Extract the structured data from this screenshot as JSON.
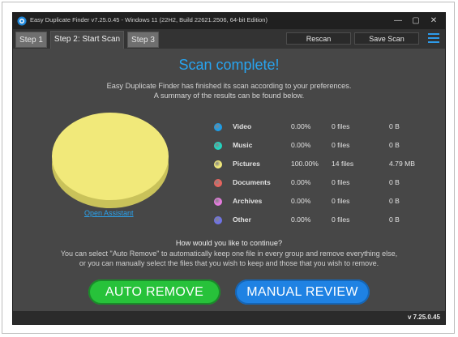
{
  "window": {
    "title": "Easy Duplicate Finder v7.25.0.45 - Windows 11 (22H2, Build 22621.2506, 64-bit Edition)",
    "controls": {
      "minimize": "—",
      "maximize": "▢",
      "close": "✕"
    }
  },
  "tabs": [
    {
      "label": "Step 1",
      "active": false
    },
    {
      "label": "Step 2: Start Scan",
      "active": true
    },
    {
      "label": "Step 3",
      "active": false
    }
  ],
  "toolbar": {
    "rescan_label": "Rescan",
    "save_scan_label": "Save Scan"
  },
  "main": {
    "headline": "Scan complete!",
    "summary_line1": "Easy Duplicate Finder has finished its scan according to your preferences.",
    "summary_line2": "A summary of the results can be found below.",
    "assistant_link": "Open Assistant",
    "question": "How would you like to continue?",
    "instructions_line1": "You can select \"Auto Remove\" to automatically keep one file in every group and remove everything else,",
    "instructions_line2": "or you can manually select the files that you wish to keep and those that you wish to remove."
  },
  "categories": [
    {
      "name": "Video",
      "percent": "0.00%",
      "files": "0 files",
      "size": "0 B",
      "color": "#1d9ee8"
    },
    {
      "name": "Music",
      "percent": "0.00%",
      "files": "0 files",
      "size": "0 B",
      "color": "#20d6c0"
    },
    {
      "name": "Pictures",
      "percent": "100.00%",
      "files": "14 files",
      "size": "4.79 MB",
      "color": "#f1e97a"
    },
    {
      "name": "Documents",
      "percent": "0.00%",
      "files": "0 files",
      "size": "0 B",
      "color": "#e8645e"
    },
    {
      "name": "Archives",
      "percent": "0.00%",
      "files": "0 files",
      "size": "0 B",
      "color": "#e77be0"
    },
    {
      "name": "Other",
      "percent": "0.00%",
      "files": "0 files",
      "size": "0 B",
      "color": "#6f73e8"
    }
  ],
  "actions": {
    "auto_remove": "AUTO REMOVE",
    "manual_review": "MANUAL REVIEW"
  },
  "footer": {
    "version": "v 7.25.0.45"
  },
  "colors": {
    "accent": "#28a4f0",
    "auto_remove": "#27c23a",
    "manual_review": "#1f82e3",
    "pie": "#f1e97a"
  }
}
